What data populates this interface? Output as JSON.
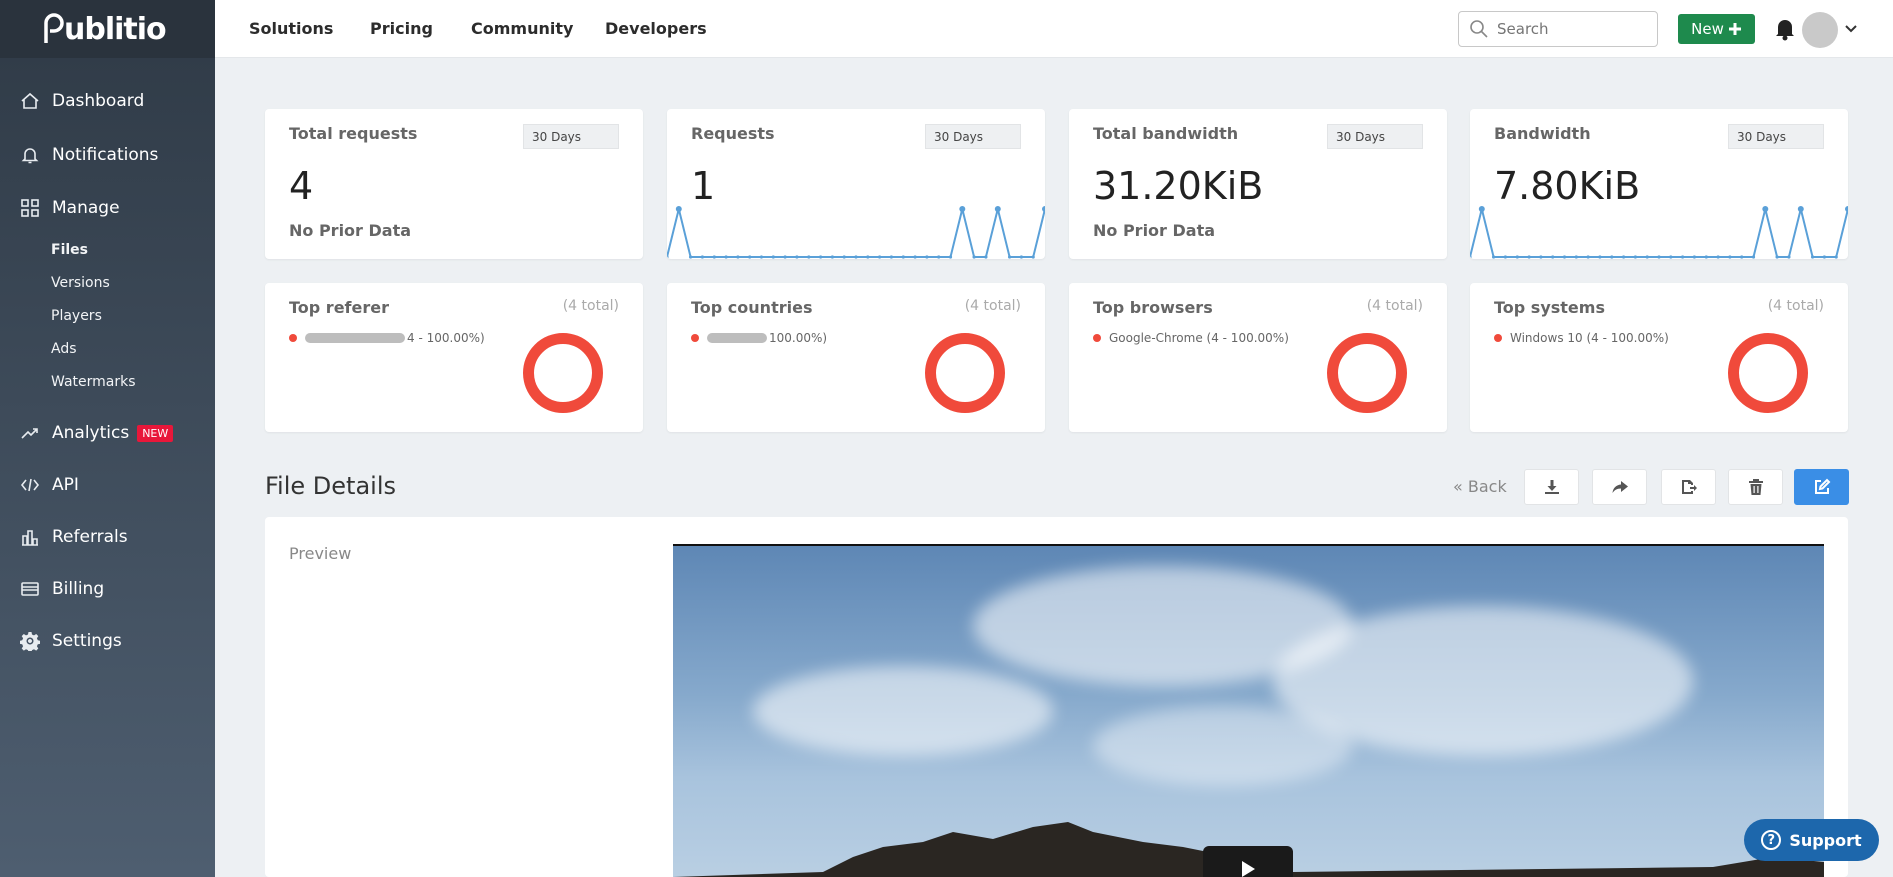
{
  "brand": {
    "logo_text": "ublitio"
  },
  "sidebar": {
    "items": [
      {
        "label": "Dashboard",
        "icon": "home-icon"
      },
      {
        "label": "Notifications",
        "icon": "bell-icon"
      },
      {
        "label": "Manage",
        "icon": "grid-icon"
      },
      {
        "label": "Analytics",
        "icon": "trend-icon",
        "badge": "NEW"
      },
      {
        "label": "API",
        "icon": "code-icon"
      },
      {
        "label": "Referrals",
        "icon": "bar-chart-icon"
      },
      {
        "label": "Billing",
        "icon": "card-icon"
      },
      {
        "label": "Settings",
        "icon": "gear-icon"
      }
    ],
    "manage_sub": [
      {
        "label": "Files",
        "active": true
      },
      {
        "label": "Versions"
      },
      {
        "label": "Players"
      },
      {
        "label": "Ads"
      },
      {
        "label": "Watermarks"
      }
    ]
  },
  "topnav": {
    "links": [
      "Solutions",
      "Pricing",
      "Community",
      "Developers"
    ],
    "search_placeholder": "Search",
    "new_label": "New"
  },
  "stats": [
    {
      "title": "Total requests",
      "range": "30 Days",
      "value": "4",
      "sub": "No Prior Data"
    },
    {
      "title": "Requests",
      "range": "30 Days",
      "value": "1",
      "sparkline": [
        0,
        1,
        0,
        0,
        0,
        0,
        0,
        0,
        0,
        0,
        0,
        0,
        0,
        0,
        0,
        0,
        0,
        0,
        0,
        0,
        0,
        0,
        0,
        0,
        0,
        1,
        0,
        0,
        1,
        0,
        0,
        0,
        1
      ]
    },
    {
      "title": "Total bandwidth",
      "range": "30 Days",
      "value": "31.20KiB",
      "sub": "No Prior Data"
    },
    {
      "title": "Bandwidth",
      "range": "30 Days",
      "value": "7.80KiB",
      "sparkline": [
        0,
        1,
        0,
        0,
        0,
        0,
        0,
        0,
        0,
        0,
        0,
        0,
        0,
        0,
        0,
        0,
        0,
        0,
        0,
        0,
        0,
        0,
        0,
        0,
        0,
        1,
        0,
        0,
        1,
        0,
        0,
        0,
        1
      ]
    }
  ],
  "tops": [
    {
      "title": "Top referer",
      "total": "(4 total)",
      "legend": "4 - 100.00%)"
    },
    {
      "title": "Top countries",
      "total": "(4 total)",
      "legend": "100.00%)"
    },
    {
      "title": "Top browsers",
      "total": "(4 total)",
      "legend": "Google-Chrome (4 - 100.00%)"
    },
    {
      "title": "Top systems",
      "total": "(4 total)",
      "legend": "Windows 10 (4 - 100.00%)"
    }
  ],
  "colors": {
    "accent": "#f04a3b",
    "spark": "#5aa0d8",
    "primary": "#3a8ee6",
    "new_button": "#1e8a4d"
  },
  "file_details": {
    "title": "File Details",
    "back_label": "« Back",
    "preview_label": "Preview",
    "tools": [
      "download-icon",
      "share-icon",
      "export-icon",
      "trash-icon",
      "edit-icon"
    ]
  },
  "support": {
    "label": "Support"
  }
}
